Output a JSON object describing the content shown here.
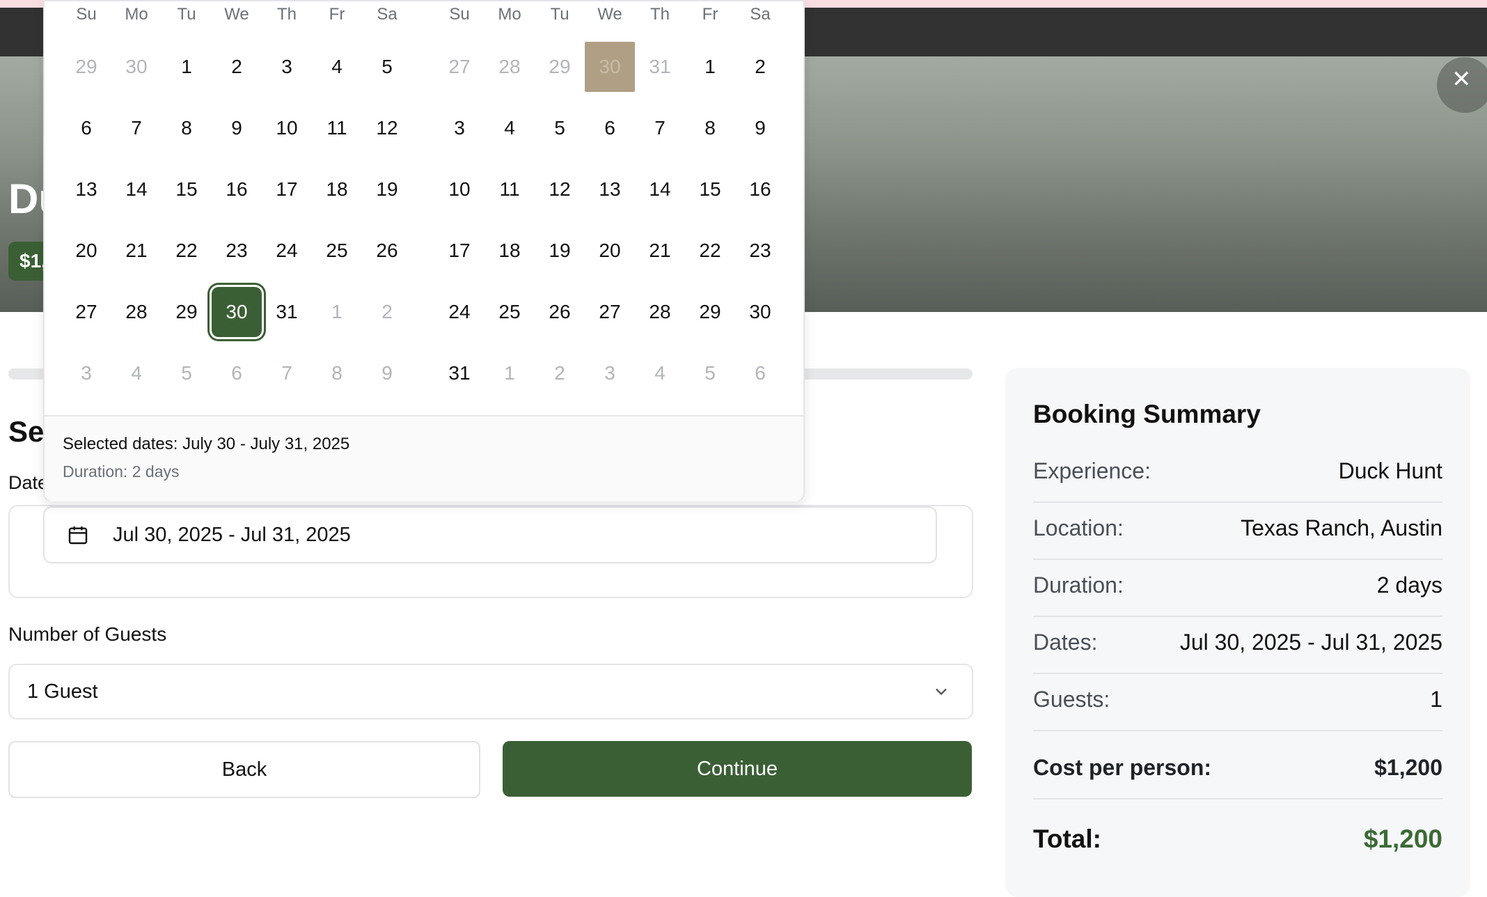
{
  "hero": {
    "title_partial": "Du",
    "price_partial": "$1,"
  },
  "form": {
    "section_title_partial": "Se",
    "dates_label_partial": "Date",
    "date_value": "Jul 30, 2025 - Jul 31, 2025",
    "guests_label": "Number of Guests",
    "guests_value": "1 Guest",
    "back_label": "Back",
    "continue_label": "Continue"
  },
  "calendar": {
    "weekdays": [
      "Su",
      "Mo",
      "Tu",
      "We",
      "Th",
      "Fr",
      "Sa"
    ],
    "left_month_days": [
      [
        "29",
        "30",
        "1",
        "2",
        "3",
        "4",
        "5"
      ],
      [
        "6",
        "7",
        "8",
        "9",
        "10",
        "11",
        "12"
      ],
      [
        "13",
        "14",
        "15",
        "16",
        "17",
        "18",
        "19"
      ],
      [
        "20",
        "21",
        "22",
        "23",
        "24",
        "25",
        "26"
      ],
      [
        "27",
        "28",
        "29",
        "30",
        "31",
        "1",
        "2"
      ],
      [
        "3",
        "4",
        "5",
        "6",
        "7",
        "8",
        "9"
      ]
    ],
    "right_month_days": [
      [
        "27",
        "28",
        "29",
        "30",
        "31",
        "1",
        "2"
      ],
      [
        "3",
        "4",
        "5",
        "6",
        "7",
        "8",
        "9"
      ],
      [
        "10",
        "11",
        "12",
        "13",
        "14",
        "15",
        "16"
      ],
      [
        "17",
        "18",
        "19",
        "20",
        "21",
        "22",
        "23"
      ],
      [
        "24",
        "25",
        "26",
        "27",
        "28",
        "29",
        "30"
      ],
      [
        "31",
        "1",
        "2",
        "3",
        "4",
        "5",
        "6"
      ]
    ],
    "selected_text": "Selected dates: July 30 - July 31, 2025",
    "duration_text": "Duration: 2 days"
  },
  "summary": {
    "title": "Booking Summary",
    "rows": [
      {
        "label": "Experience:",
        "value": "Duck Hunt"
      },
      {
        "label": "Location:",
        "value": "Texas Ranch, Austin"
      },
      {
        "label": "Duration:",
        "value": "2 days"
      },
      {
        "label": "Dates:",
        "value": "Jul 30, 2025 - Jul 31, 2025"
      },
      {
        "label": "Guests:",
        "value": "1"
      }
    ],
    "cost_label": "Cost per person:",
    "cost_value": "$1,200",
    "total_label": "Total:",
    "total_value": "$1,200"
  },
  "colors": {
    "accent": "#3b5f35",
    "range_highlight": "#b19f85",
    "total_green": "#3b6a35"
  }
}
